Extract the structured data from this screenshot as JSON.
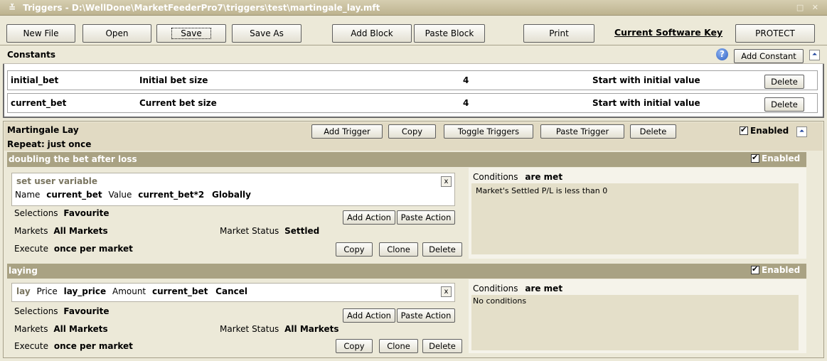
{
  "window": {
    "title": "Triggers - D:\\WellDone\\MarketFeederPro7\\triggers\\test\\martingale_lay.mft",
    "controls": "□ ✕",
    "menu_glyph": "≚"
  },
  "toolbar": {
    "new_file": "New File",
    "open": "Open",
    "save": "Save",
    "save_as": "Save As",
    "add_block": "Add Block",
    "paste_block": "Paste Block",
    "print": "Print",
    "software_key": "Current Software Key",
    "protect": "PROTECT"
  },
  "constants": {
    "title": "Constants",
    "help": "?",
    "add_label": "Add Constant",
    "rows": [
      {
        "name": "initial_bet",
        "description": "Initial bet size",
        "value": "4",
        "mode": "Start with initial value",
        "delete": "Delete"
      },
      {
        "name": "current_bet",
        "description": "Current bet size",
        "value": "4",
        "mode": "Start with initial value",
        "delete": "Delete"
      }
    ]
  },
  "block": {
    "name": "Martingale Lay",
    "repeat_label": "Repeat:",
    "repeat_value": "just once",
    "add_trigger": "Add Trigger",
    "copy": "Copy",
    "toggle": "Toggle Triggers",
    "paste_trigger": "Paste Trigger",
    "delete": "Delete",
    "enabled": "Enabled",
    "triggers": [
      {
        "name": "doubling the bet after loss",
        "enabled": "Enabled",
        "action_title": "set user variable",
        "action_line": [
          {
            "t": "Name",
            "b": false
          },
          {
            "t": "current_bet",
            "b": true
          },
          {
            "t": "Value",
            "b": false
          },
          {
            "t": "current_bet*2",
            "b": true
          },
          {
            "t": "Globally",
            "b": true
          }
        ],
        "selections_label": "Selections",
        "selections": "Favourite",
        "markets_label": "Markets",
        "markets": "All Markets",
        "status_label": "Market Status",
        "status": "Settled",
        "execute_label": "Execute",
        "execute": "once per market",
        "add_action": "Add Action",
        "paste_action": "Paste Action",
        "copy": "Copy",
        "clone": "Clone",
        "delete": "Delete",
        "conditions_label": "Conditions",
        "conditions_state": "are met",
        "conditions_text": "Market's Settled P/L is less than 0",
        "close": "x"
      },
      {
        "name": "laying",
        "enabled": "Enabled",
        "action_title": "lay",
        "action_line": [
          {
            "t": "Price",
            "b": false
          },
          {
            "t": "lay_price",
            "b": true
          },
          {
            "t": "Amount",
            "b": false
          },
          {
            "t": "current_bet",
            "b": true
          },
          {
            "t": "Cancel",
            "b": true
          }
        ],
        "selections_label": "Selections",
        "selections": "Favourite",
        "markets_label": "Markets",
        "markets": "All Markets",
        "status_label": "Market Status",
        "status": "All Markets",
        "execute_label": "Execute",
        "execute": "once per market",
        "add_action": "Add Action",
        "paste_action": "Paste Action",
        "copy": "Copy",
        "clone": "Clone",
        "delete": "Delete",
        "conditions_label": "Conditions",
        "conditions_state": "are met",
        "conditions_text": "No conditions",
        "close": "x"
      }
    ]
  }
}
